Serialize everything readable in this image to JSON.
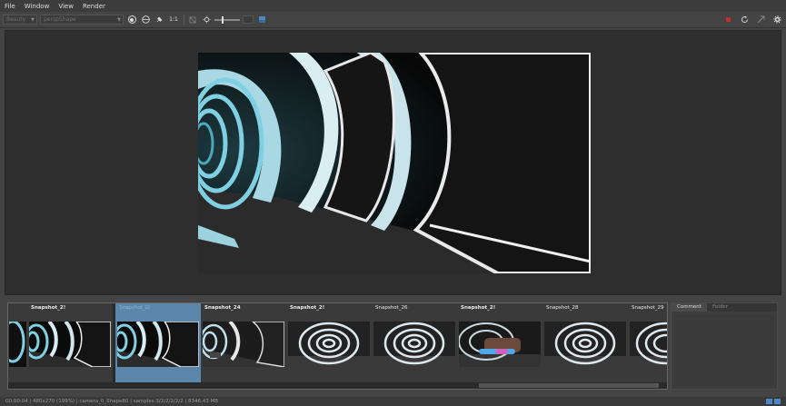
{
  "menu": [
    "File",
    "Window",
    "View",
    "Render"
  ],
  "toolbar": {
    "mode_value": "Beauty",
    "camera_value": "perspShape",
    "ratio_label": "1:1"
  },
  "icons": {
    "sphere": "render-sphere-icon",
    "grid": "globe-icon",
    "pin": "pin-icon",
    "aov": "aov-icon",
    "exposure": "exposure-icon",
    "color": "color-picker-icon",
    "stop": "stop-icon",
    "refresh": "refresh-icon",
    "share": "share-icon",
    "settings": "gear-icon"
  },
  "snapshots": [
    {
      "label": "Snapshot_2!"
    },
    {
      "label": "Snapshot_2("
    },
    {
      "label": "Snapshot_24"
    },
    {
      "label": "Snapshot_2!"
    },
    {
      "label": "Snapshot_26"
    },
    {
      "label": "Snapshot_2!"
    },
    {
      "label": "Snapshot_28"
    },
    {
      "label": "Snapshot_29"
    }
  ],
  "panel": {
    "tabs": [
      "Comment",
      "Folder"
    ]
  },
  "status": {
    "text": "00:00:04 | 480x270 (199%) | camera_0_Shape80 | samples 3/2/2/2/2/2 | 8346.43 MB"
  },
  "colors": {
    "selected": "#5b87ad",
    "accent_blue": "#4f87c2",
    "stop_red": "#c03030"
  }
}
